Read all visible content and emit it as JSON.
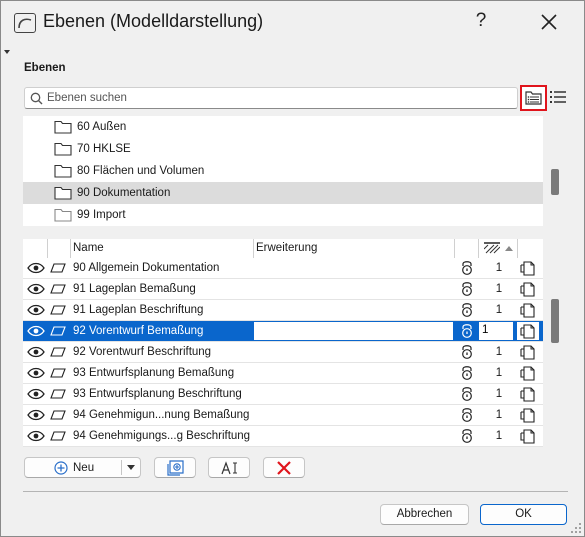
{
  "window": {
    "title": "Ebenen (Modelldarstellung)",
    "help_label": "?"
  },
  "section": {
    "title": "Ebenen"
  },
  "search": {
    "placeholder": "Ebenen suchen",
    "value": ""
  },
  "folders": [
    {
      "label": "60 Außen",
      "selected": false
    },
    {
      "label": "70 HKLSE",
      "selected": false
    },
    {
      "label": "80 Flächen und Volumen",
      "selected": false
    },
    {
      "label": "90 Dokumentation",
      "selected": true
    },
    {
      "label": "99 Import",
      "selected": false
    }
  ],
  "table": {
    "columns": {
      "name": "Name",
      "extension": "Erweiterung"
    },
    "rows": [
      {
        "name": "90 Allgemein Dokumentation",
        "extension": "",
        "number": "1"
      },
      {
        "name": "91 Lageplan Bemaßung",
        "extension": "",
        "number": "1"
      },
      {
        "name": "91 Lageplan Beschriftung",
        "extension": "",
        "number": "1"
      },
      {
        "name": "92 Vorentwurf Bemaßung",
        "extension": "",
        "number": "1",
        "selected": true
      },
      {
        "name": "92 Vorentwurf Beschriftung",
        "extension": "",
        "number": "1"
      },
      {
        "name": "93 Entwurfsplanung Bemaßung",
        "extension": "",
        "number": "1"
      },
      {
        "name": "93 Entwurfsplanung Beschriftung",
        "extension": "",
        "number": "1"
      },
      {
        "name": "94 Genehmigun...nung Bemaßung",
        "extension": "",
        "number": "1"
      },
      {
        "name": "94 Genehmigungs...g Beschriftung",
        "extension": "",
        "number": "1"
      }
    ]
  },
  "toolbar": {
    "new_label": "Neu"
  },
  "footer": {
    "cancel_label": "Abbrechen",
    "ok_label": "OK"
  },
  "colors": {
    "selection": "#0a66cc",
    "highlight_border": "#e0141c",
    "delete_icon": "#e0141c",
    "add_icon": "#2a6fc9"
  }
}
